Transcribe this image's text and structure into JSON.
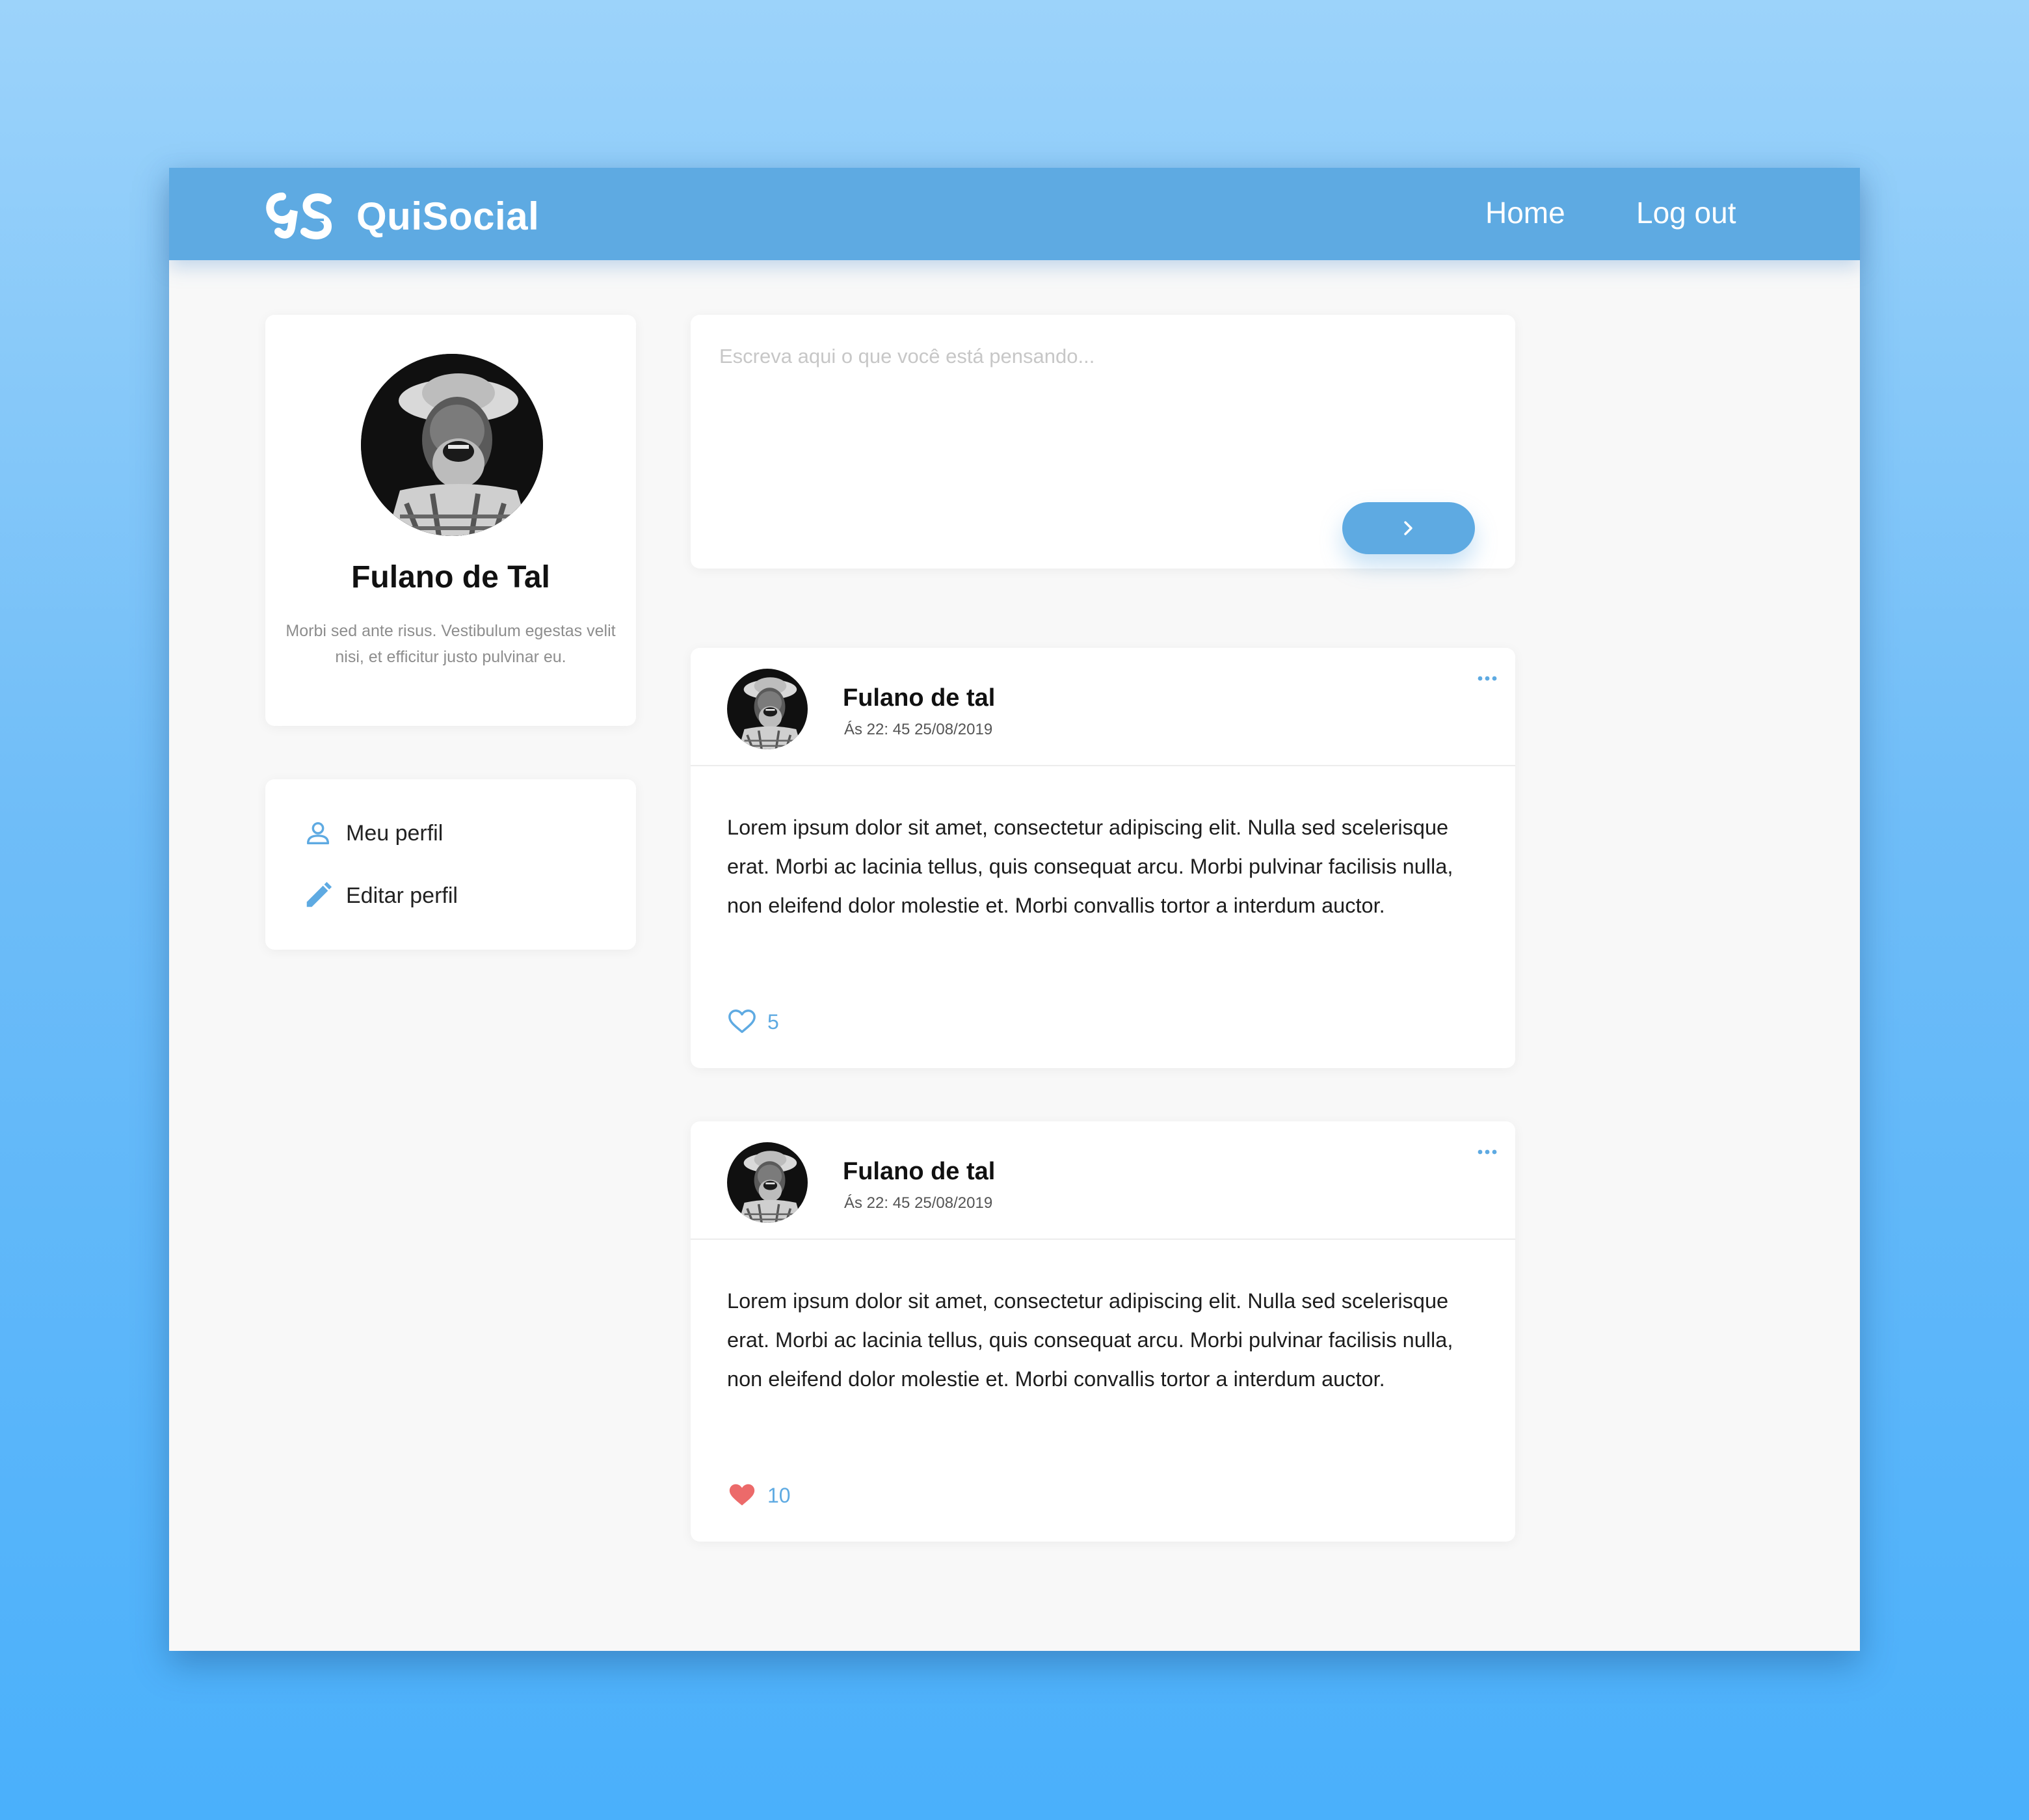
{
  "app": {
    "name": "QuiSocial",
    "logo_icon": "qs-logo-icon"
  },
  "nav": {
    "home_label": "Home",
    "logout_label": "Log out"
  },
  "profile": {
    "name": "Fulano de Tal",
    "bio": "Morbi sed ante risus. Vestibulum egestas velit nisi, et efficitur justo pulvinar eu."
  },
  "menu": {
    "items": [
      {
        "label": "Meu perfil",
        "icon": "user-icon"
      },
      {
        "label": "Editar perfil",
        "icon": "pencil-icon"
      }
    ]
  },
  "composer": {
    "placeholder": "Escreva aqui o que você está pensando...",
    "submit_icon": "chevron-right-icon"
  },
  "posts": [
    {
      "author": "Fulano de tal",
      "time": "Ás 22: 45 25/08/2019",
      "text": "Lorem ipsum dolor sit amet, consectetur adipiscing elit. Nulla sed scelerisque erat. Morbi ac lacinia tellus, quis consequat arcu. Morbi pulvinar facilisis nulla, non eleifend dolor molestie et. Morbi convallis tortor a interdum auctor.",
      "likes": "5",
      "liked": false
    },
    {
      "author": "Fulano de tal",
      "time": "Ás 22: 45 25/08/2019",
      "text": "Lorem ipsum dolor sit amet, consectetur adipiscing elit. Nulla sed scelerisque erat. Morbi ac lacinia tellus, quis consequat arcu. Morbi pulvinar facilisis nulla, non eleifend dolor molestie et. Morbi convallis tortor a interdum auctor.",
      "likes": "10",
      "liked": true
    }
  ],
  "colors": {
    "accent": "#5eaae2",
    "like_active": "#ec6a6a",
    "background_top": "#9cd3fa",
    "background_bottom": "#4ab0fb"
  }
}
